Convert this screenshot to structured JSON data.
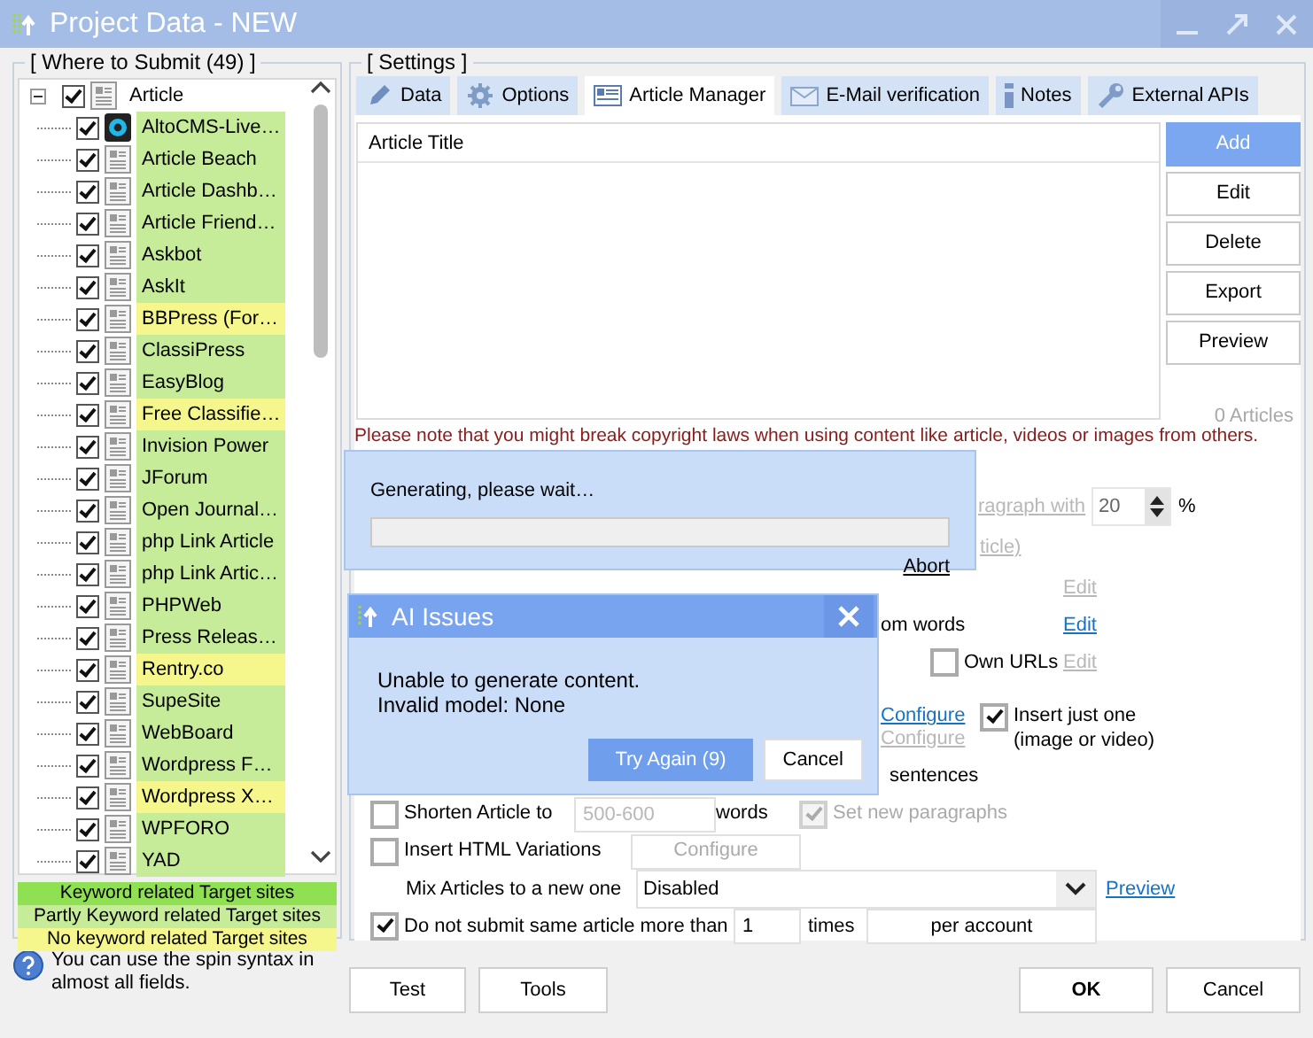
{
  "window": {
    "title": "Project Data - NEW"
  },
  "submit_panel": {
    "title": "[ Where to Submit  (49) ]",
    "tree": [
      {
        "label": "Article",
        "checked": true,
        "expanded": true,
        "children": [
          {
            "label": "AltoCMS-Live…",
            "checked": true,
            "color": "#c6ec9a"
          },
          {
            "label": "Article Beach",
            "checked": true,
            "color": "#c6ec9a"
          },
          {
            "label": "Article Dashb…",
            "checked": true,
            "color": "#c6ec9a"
          },
          {
            "label": "Article Friend…",
            "checked": true,
            "color": "#c6ec9a"
          },
          {
            "label": "Askbot",
            "checked": true,
            "color": "#c6ec9a"
          },
          {
            "label": "AskIt",
            "checked": true,
            "color": "#c6ec9a"
          },
          {
            "label": "BBPress (For…",
            "checked": true,
            "color": "#f5f78c"
          },
          {
            "label": "ClassiPress",
            "checked": true,
            "color": "#c6ec9a"
          },
          {
            "label": "EasyBlog",
            "checked": true,
            "color": "#c6ec9a"
          },
          {
            "label": "Free Classifie…",
            "checked": true,
            "color": "#f5f78c"
          },
          {
            "label": "Invision Power",
            "checked": true,
            "color": "#c6ec9a"
          },
          {
            "label": "JForum",
            "checked": true,
            "color": "#c6ec9a"
          },
          {
            "label": "Open Journal…",
            "checked": true,
            "color": "#c6ec9a"
          },
          {
            "label": "php Link Article",
            "checked": true,
            "color": "#c6ec9a"
          },
          {
            "label": "php Link Artic…",
            "checked": true,
            "color": "#c6ec9a"
          },
          {
            "label": "PHPWeb",
            "checked": true,
            "color": "#c6ec9a"
          },
          {
            "label": "Press Releas…",
            "checked": true,
            "color": "#c6ec9a"
          },
          {
            "label": "Rentry.co",
            "checked": true,
            "color": "#f5f78c"
          },
          {
            "label": "SupeSite",
            "checked": true,
            "color": "#c6ec9a"
          },
          {
            "label": "WebBoard",
            "checked": true,
            "color": "#c6ec9a"
          },
          {
            "label": "Wordpress F…",
            "checked": true,
            "color": "#c6ec9a"
          },
          {
            "label": "Wordpress X…",
            "checked": true,
            "color": "#f5f78c"
          },
          {
            "label": "WPFORO",
            "checked": true,
            "color": "#c6ec9a"
          },
          {
            "label": "YAD",
            "checked": true,
            "color": "#c6ec9a"
          }
        ]
      }
    ],
    "legend": [
      {
        "label": "Keyword related Target sites",
        "color": "#8fe052"
      },
      {
        "label": "Partly Keyword related Target sites",
        "color": "#c6ec9a"
      },
      {
        "label": "No keyword related Target sites",
        "color": "#f5f78c"
      }
    ],
    "hint": "You can use the spin syntax in almost all fields."
  },
  "settings": {
    "title": "[ Settings ]",
    "tabs": [
      {
        "label": "Data",
        "selected": false
      },
      {
        "label": "Options",
        "selected": false
      },
      {
        "label": "Article Manager",
        "selected": true
      },
      {
        "label": "E-Mail verification",
        "selected": false
      },
      {
        "label": "Notes",
        "selected": false
      },
      {
        "label": "External APIs",
        "selected": false
      }
    ],
    "article_list": {
      "columns": [
        "Article Title"
      ],
      "buttons": [
        {
          "label": "Add",
          "primary": true
        },
        {
          "label": "Edit",
          "primary": false
        },
        {
          "label": "Delete",
          "primary": false
        },
        {
          "label": "Export",
          "primary": false
        },
        {
          "label": "Preview",
          "primary": false
        }
      ],
      "count": "0 Articles"
    },
    "warning": "Please note that you might break copyright laws when using content like article, videos or images from others.",
    "options": [
      {
        "items": [
          {
            "kind": "link",
            "text": "ragraph with",
            "disabled": true
          },
          {
            "kind": "spin",
            "value": "20"
          },
          {
            "kind": "text",
            "text": "%"
          }
        ]
      },
      {
        "items": [
          {
            "kind": "link",
            "text": "ticle)",
            "disabled": true
          }
        ]
      },
      {
        "items": [
          {
            "kind": "link",
            "text": "Edit",
            "disabled": true
          }
        ]
      },
      {
        "items": [
          {
            "kind": "text",
            "text": "om words"
          },
          {
            "kind": "link",
            "text": "Edit",
            "disabled": false
          }
        ]
      },
      {
        "items": [
          {
            "kind": "checkbox",
            "label": "Own URLs",
            "checked": false,
            "disabled": false
          },
          {
            "kind": "link",
            "text": "Edit",
            "disabled": true
          }
        ]
      },
      {
        "items": [
          {
            "kind": "link",
            "text": "Configure",
            "disabled": false
          },
          {
            "kind": "checkbox",
            "label": "Insert just one (image or video)",
            "checked": true,
            "disabled": false
          }
        ]
      },
      {
        "items": [
          {
            "kind": "link",
            "text": "Configure",
            "disabled": true
          }
        ]
      },
      {
        "items": [
          {
            "kind": "text",
            "text": "sentences"
          }
        ]
      },
      {
        "items": [
          {
            "kind": "checkbox",
            "label": "Shorten Article to",
            "checked": false,
            "disabled": false
          },
          {
            "kind": "field",
            "value": "500-600",
            "disabled": true
          },
          {
            "kind": "text",
            "text": "words"
          },
          {
            "kind": "checkbox",
            "label": "Set new paragraphs",
            "checked": true,
            "disabled": true
          }
        ]
      },
      {
        "items": [
          {
            "kind": "checkbox",
            "label": "Insert HTML Variations",
            "checked": false,
            "disabled": false
          },
          {
            "kind": "button",
            "label": "Configure",
            "disabled": true
          }
        ]
      },
      {
        "items": [
          {
            "kind": "text",
            "text": "Mix Articles to a new one"
          },
          {
            "kind": "select",
            "value": "Disabled"
          },
          {
            "kind": "link",
            "text": "Preview",
            "disabled": false
          }
        ]
      },
      {
        "items": [
          {
            "kind": "checkbox",
            "label": "Do not submit same article more than",
            "checked": true,
            "disabled": false
          },
          {
            "kind": "field",
            "value": "1",
            "disabled": false
          },
          {
            "kind": "text",
            "text": "times"
          },
          {
            "kind": "button",
            "label": "per account",
            "disabled": false
          }
        ]
      }
    ]
  },
  "generating_dialog": {
    "message": "Generating, please wait…",
    "level": 0,
    "abort": "Abort"
  },
  "ai_issues_dialog": {
    "title": "AI Issues",
    "message_lines": [
      "Unable to generate content.",
      "Invalid model: None"
    ],
    "buttons": [
      {
        "label": "Try Again (9)",
        "primary": true
      },
      {
        "label": "Cancel",
        "primary": false
      }
    ]
  },
  "footer_buttons": [
    {
      "label": "Test",
      "default": false
    },
    {
      "label": "Tools",
      "default": false
    },
    {
      "label": "OK",
      "default": true
    },
    {
      "label": "Cancel",
      "default": false
    }
  ]
}
